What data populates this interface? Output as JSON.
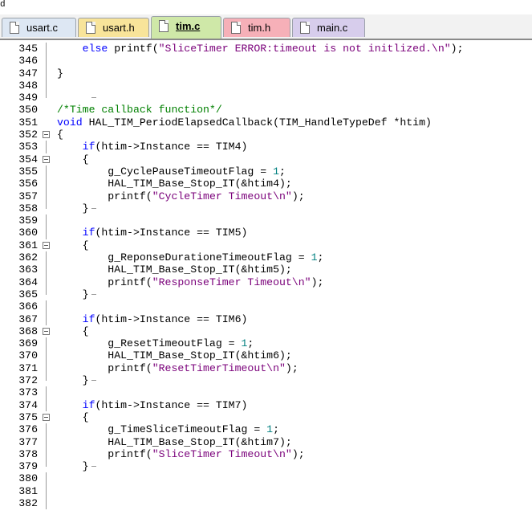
{
  "top_char": "d",
  "tabs": [
    {
      "label": "usart.c",
      "color": "#dde7f3",
      "active": false
    },
    {
      "label": "usart.h",
      "color": "#f8e49a",
      "active": false
    },
    {
      "label": "tim.c",
      "color": "#cfe8a8",
      "active": true
    },
    {
      "label": "tim.h",
      "color": "#f6b0b8",
      "active": false
    },
    {
      "label": "main.c",
      "color": "#d7cdec",
      "active": false
    }
  ],
  "fold_glyph_names": [
    "fold-collapse-icon",
    "fold-bar",
    "fold-end"
  ],
  "code": [
    {
      "ln": "345",
      "fold": "bar",
      "tokens": [
        [
          "tx",
          "    "
        ],
        [
          "kw",
          "else"
        ],
        [
          "tx",
          " printf("
        ],
        [
          "st",
          "\"SliceTimer ERROR:timeout is not initlized.\\n\""
        ],
        [
          "tx",
          ");"
        ]
      ]
    },
    {
      "ln": "346",
      "fold": "bar",
      "tokens": []
    },
    {
      "ln": "347",
      "fold": "bar",
      "tokens": [
        [
          "tx",
          "}"
        ]
      ]
    },
    {
      "ln": "348",
      "fold": "bar",
      "tokens": []
    },
    {
      "ln": "349",
      "fold": "end",
      "tokens": []
    },
    {
      "ln": "350",
      "fold": "",
      "tokens": [
        [
          "cm",
          "/*Time callback function*/"
        ]
      ]
    },
    {
      "ln": "351",
      "fold": "",
      "tokens": [
        [
          "kw",
          "void"
        ],
        [
          "tx",
          " HAL_TIM_PeriodElapsedCallback(TIM_HandleTypeDef *htim)"
        ]
      ]
    },
    {
      "ln": "352",
      "fold": "box",
      "tokens": [
        [
          "tx",
          "{"
        ]
      ]
    },
    {
      "ln": "353",
      "fold": "bar",
      "tokens": [
        [
          "tx",
          "    "
        ],
        [
          "kw",
          "if"
        ],
        [
          "tx",
          "(htim->Instance == TIM4)"
        ]
      ]
    },
    {
      "ln": "354",
      "fold": "box",
      "tokens": [
        [
          "tx",
          "    {"
        ]
      ]
    },
    {
      "ln": "355",
      "fold": "bar",
      "tokens": [
        [
          "tx",
          "        g_CyclePauseTimeoutFlag = "
        ],
        [
          "nm",
          "1"
        ],
        [
          "tx",
          ";"
        ]
      ]
    },
    {
      "ln": "356",
      "fold": "bar",
      "tokens": [
        [
          "tx",
          "        HAL_TIM_Base_Stop_IT(&htim4);"
        ]
      ]
    },
    {
      "ln": "357",
      "fold": "bar",
      "tokens": [
        [
          "tx",
          "        printf("
        ],
        [
          "st",
          "\"CycleTimer Timeout\\n\""
        ],
        [
          "tx",
          ");"
        ]
      ]
    },
    {
      "ln": "358",
      "fold": "end",
      "tokens": [
        [
          "tx",
          "    }"
        ]
      ]
    },
    {
      "ln": "359",
      "fold": "bar",
      "tokens": []
    },
    {
      "ln": "360",
      "fold": "bar",
      "tokens": [
        [
          "tx",
          "    "
        ],
        [
          "kw",
          "if"
        ],
        [
          "tx",
          "(htim->Instance == TIM5)"
        ]
      ]
    },
    {
      "ln": "361",
      "fold": "box",
      "tokens": [
        [
          "tx",
          "    {"
        ]
      ]
    },
    {
      "ln": "362",
      "fold": "bar",
      "tokens": [
        [
          "tx",
          "        g_ReponseDurationeTimeoutFlag = "
        ],
        [
          "nm",
          "1"
        ],
        [
          "tx",
          ";"
        ]
      ]
    },
    {
      "ln": "363",
      "fold": "bar",
      "tokens": [
        [
          "tx",
          "        HAL_TIM_Base_Stop_IT(&htim5);"
        ]
      ]
    },
    {
      "ln": "364",
      "fold": "bar",
      "tokens": [
        [
          "tx",
          "        printf("
        ],
        [
          "st",
          "\"ResponseTimer Timeout\\n\""
        ],
        [
          "tx",
          ");"
        ]
      ]
    },
    {
      "ln": "365",
      "fold": "end",
      "tokens": [
        [
          "tx",
          "    }"
        ]
      ]
    },
    {
      "ln": "366",
      "fold": "bar",
      "tokens": []
    },
    {
      "ln": "367",
      "fold": "bar",
      "tokens": [
        [
          "tx",
          "    "
        ],
        [
          "kw",
          "if"
        ],
        [
          "tx",
          "(htim->Instance == TIM6)"
        ]
      ]
    },
    {
      "ln": "368",
      "fold": "box",
      "tokens": [
        [
          "tx",
          "    {"
        ]
      ]
    },
    {
      "ln": "369",
      "fold": "bar",
      "tokens": [
        [
          "tx",
          "        g_ResetTimeoutFlag = "
        ],
        [
          "nm",
          "1"
        ],
        [
          "tx",
          ";"
        ]
      ]
    },
    {
      "ln": "370",
      "fold": "bar",
      "tokens": [
        [
          "tx",
          "        HAL_TIM_Base_Stop_IT(&htim6);"
        ]
      ]
    },
    {
      "ln": "371",
      "fold": "bar",
      "tokens": [
        [
          "tx",
          "        printf("
        ],
        [
          "st",
          "\"ResetTimerTimeout\\n\""
        ],
        [
          "tx",
          ");"
        ]
      ]
    },
    {
      "ln": "372",
      "fold": "end",
      "tokens": [
        [
          "tx",
          "    }"
        ]
      ]
    },
    {
      "ln": "373",
      "fold": "bar",
      "tokens": []
    },
    {
      "ln": "374",
      "fold": "bar",
      "tokens": [
        [
          "tx",
          "    "
        ],
        [
          "kw",
          "if"
        ],
        [
          "tx",
          "(htim->Instance == TIM7)"
        ]
      ]
    },
    {
      "ln": "375",
      "fold": "box",
      "tokens": [
        [
          "tx",
          "    {"
        ]
      ]
    },
    {
      "ln": "376",
      "fold": "bar",
      "tokens": [
        [
          "tx",
          "        g_TimeSliceTimeoutFlag = "
        ],
        [
          "nm",
          "1"
        ],
        [
          "tx",
          ";"
        ]
      ]
    },
    {
      "ln": "377",
      "fold": "bar",
      "tokens": [
        [
          "tx",
          "        HAL_TIM_Base_Stop_IT(&htim7);"
        ]
      ]
    },
    {
      "ln": "378",
      "fold": "bar",
      "tokens": [
        [
          "tx",
          "        printf("
        ],
        [
          "st",
          "\"SliceTimer Timeout\\n\""
        ],
        [
          "tx",
          ");"
        ]
      ]
    },
    {
      "ln": "379",
      "fold": "end",
      "tokens": [
        [
          "tx",
          "    }"
        ]
      ]
    },
    {
      "ln": "380",
      "fold": "bar",
      "tokens": []
    },
    {
      "ln": "381",
      "fold": "bar",
      "tokens": []
    },
    {
      "ln": "382",
      "fold": "bar",
      "tokens": []
    }
  ]
}
